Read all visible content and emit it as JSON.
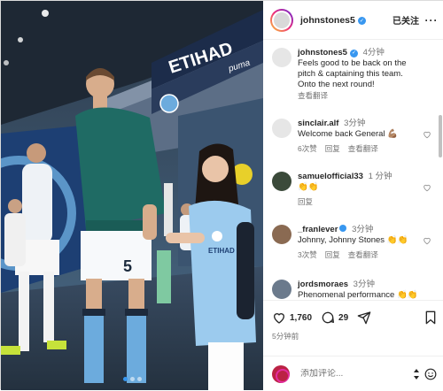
{
  "post": {
    "author": "johnstones5",
    "follow_label": "已关注",
    "more_label": "···",
    "caption_author": "johnstones5",
    "caption_time": "4分钟",
    "caption_text": "Feels good to be back on the pitch & captaining this team. Onto the next round!",
    "translate_label": "查看翻译",
    "stadium_sign": "ETIHAD",
    "brand_sign": "puma"
  },
  "comments": [
    {
      "user": "sinclair.alf",
      "time": "3分钟",
      "text": "Welcome back General 💪🏽",
      "likes": "6次赞",
      "reply": "回复",
      "translate": "查看翻译"
    },
    {
      "user": "samuelofficial33",
      "time": "1 分钟",
      "text": "👏👏",
      "likes": "",
      "reply": "回复",
      "translate": ""
    },
    {
      "user": "_franlever",
      "time": "3分钟",
      "text": "Johnny, Johnny Stones 👏👏",
      "likes": "3次赞",
      "reply": "回复",
      "translate": "查看翻译"
    },
    {
      "user": "jordsmoraes",
      "time": "3分钟",
      "text": "Phenomenal performance 👏👏",
      "likes": "",
      "reply": "",
      "translate": ""
    }
  ],
  "stats": {
    "likes": "1,760",
    "comments": "29",
    "posted_ago": "5分钟前"
  },
  "composer": {
    "placeholder": "添加评论..."
  },
  "colors": {
    "verified": "#3897f0",
    "carousel_active": "#3797f0",
    "city_blue": "#6cabdd"
  },
  "carousel": {
    "total": 3,
    "active": 1
  }
}
